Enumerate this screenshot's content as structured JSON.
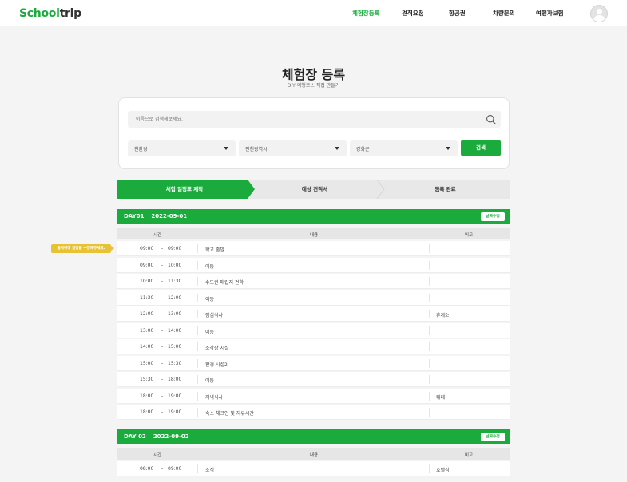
{
  "header": {
    "logo": {
      "part1": "Sc",
      "part2": "hool",
      "part3": "trip"
    },
    "nav": [
      {
        "label": "체험장등록",
        "active": true
      },
      {
        "label": "견적요청",
        "active": false
      },
      {
        "label": "항공권",
        "active": false
      },
      {
        "label": "차량문의",
        "active": false
      },
      {
        "label": "여행자보험",
        "active": false
      }
    ]
  },
  "page": {
    "title": "체험장 등록",
    "subtitle": "DIY 여행코스 직접 만들기"
  },
  "search": {
    "placeholder": "이름으로 검색해보세요.",
    "filters": [
      "친환경",
      "인천광역시",
      "강화군"
    ],
    "button": "검색"
  },
  "steps": [
    "체험 일정표 제작",
    "예상 견적서",
    "등록 완료"
  ],
  "tooltip": "클릭하여 일정을 수정해주세요.",
  "columns": {
    "time": "시간",
    "content": "내용",
    "note": "비고"
  },
  "days": [
    {
      "label": "DAY01",
      "date": "2022-09-01",
      "edit_label": "날짜수정",
      "rows": [
        {
          "start": "09:00",
          "end": "09:00",
          "content": "학교 출발",
          "note": ""
        },
        {
          "start": "09:00",
          "end": "10:00",
          "content": "이동",
          "note": ""
        },
        {
          "start": "10:00",
          "end": "11:30",
          "content": "수도권 매립지 견학",
          "note": ""
        },
        {
          "start": "11:30",
          "end": "12:00",
          "content": "이동",
          "note": ""
        },
        {
          "start": "12:00",
          "end": "13:00",
          "content": "점심식사",
          "note": "휴게소"
        },
        {
          "start": "13:00",
          "end": "14:00",
          "content": "이동",
          "note": ""
        },
        {
          "start": "14:00",
          "end": "15:00",
          "content": "소각장 시설",
          "note": ""
        },
        {
          "start": "15:00",
          "end": "15:30",
          "content": "환경 시설2",
          "note": ""
        },
        {
          "start": "15:30",
          "end": "18:00",
          "content": "이동",
          "note": ""
        },
        {
          "start": "18:00",
          "end": "19:00",
          "content": "저녁식사",
          "note": "뷔페"
        },
        {
          "start": "18:00",
          "end": "19:00",
          "content": "숙소 체크인 및 자유시간",
          "note": ""
        }
      ]
    },
    {
      "label": "DAY 02",
      "date": "2022-09-02",
      "edit_label": "날짜수정",
      "rows": [
        {
          "start": "08:00",
          "end": "09:00",
          "content": "조식",
          "note": "호텔식"
        }
      ]
    }
  ],
  "colors": {
    "accent": "#1aab3c",
    "tooltip": "#e7c334"
  }
}
